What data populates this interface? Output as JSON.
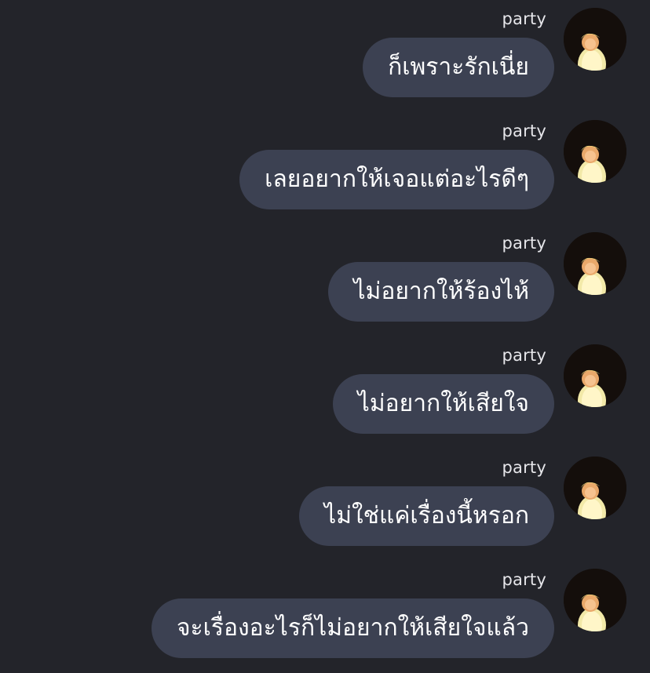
{
  "chat": {
    "messages": [
      {
        "sender": "party",
        "text": "ก็เพราะรักเนี่ย"
      },
      {
        "sender": "party",
        "text": "เลยอยากให้เจอแต่อะไรดีๆ"
      },
      {
        "sender": "party",
        "text": "ไม่อยากให้ร้องไห้"
      },
      {
        "sender": "party",
        "text": "ไม่อยากให้เสียใจ"
      },
      {
        "sender": "party",
        "text": "ไม่ใช่แค่เรื่องนี้หรอก"
      },
      {
        "sender": "party",
        "text": "จะเรื่องอะไรก็ไม่อยากให้เสียใจแล้ว"
      }
    ]
  },
  "colors": {
    "background": "#23242a",
    "bubble": "#3c4152",
    "text": "#ffffff",
    "sender": "#e6e6ea"
  },
  "icons": {
    "avatar": "profile-photo-avatar"
  }
}
